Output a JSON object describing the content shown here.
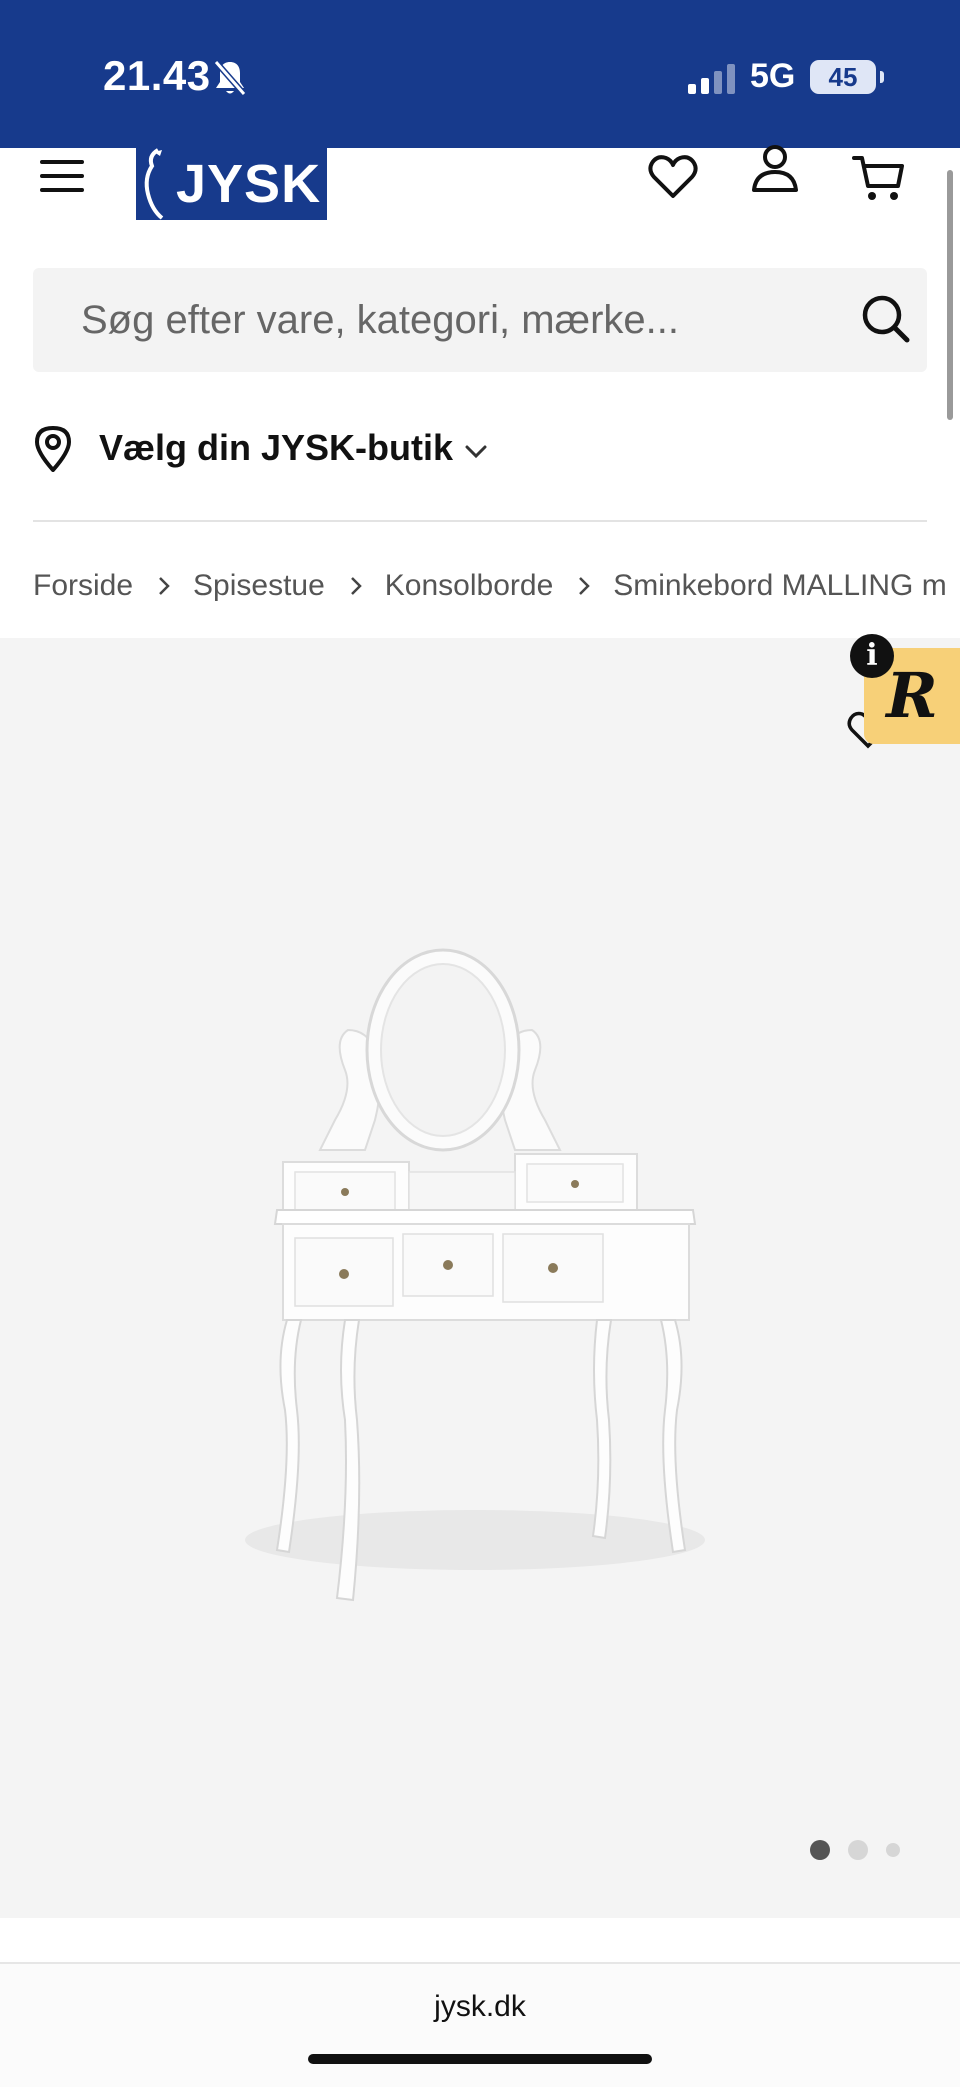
{
  "status_bar": {
    "time": "21.43",
    "network": "5G",
    "battery": "45"
  },
  "header": {
    "logo_text": "JYSK",
    "icons": [
      "menu-icon",
      "heart-icon",
      "user-icon",
      "cart-icon"
    ]
  },
  "search": {
    "placeholder": "Søg efter vare, kategori, mærke..."
  },
  "store": {
    "label": "Vælg din JYSK-butik"
  },
  "breadcrumb": {
    "items": [
      "Forside",
      "Spisestue",
      "Konsolborde",
      "Sminkebord MALLING m"
    ]
  },
  "gallery": {
    "slides_total": 3,
    "active_slide": 1,
    "badge_letter": "R",
    "info_letter": "i"
  },
  "browser": {
    "url": "jysk.dk"
  },
  "colors": {
    "brand_blue": "#173a8c",
    "badge_yellow": "#f7d078",
    "gallery_bg": "#f4f4f4"
  }
}
